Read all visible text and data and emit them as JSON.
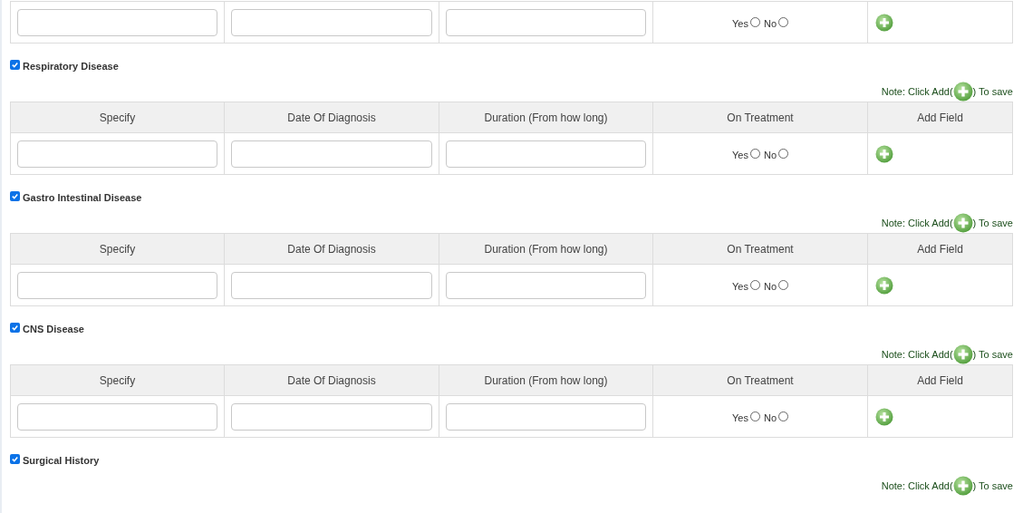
{
  "top_row": {
    "on_treatment": [
      {
        "label": "Yes",
        "selected": false
      },
      {
        "label": "No",
        "selected": false
      }
    ]
  },
  "sections": [
    {
      "title": "Respiratory Disease",
      "checked": true,
      "note": {
        "before": "Note: Click Add(",
        "after": ") To save"
      },
      "columns": [
        "Specify",
        "Date Of Diagnosis",
        "Duration (From how long)",
        "On Treatment",
        "Add Field"
      ],
      "rows": [
        {
          "on_treatment": [
            {
              "label": "Yes",
              "selected": false
            },
            {
              "label": "No",
              "selected": false
            }
          ]
        }
      ]
    },
    {
      "title": "Gastro Intestinal Disease",
      "checked": true,
      "note": {
        "before": "Note: Click Add(",
        "after": ") To save"
      },
      "columns": [
        "Specify",
        "Date Of Diagnosis",
        "Duration (From how long)",
        "On Treatment",
        "Add Field"
      ],
      "rows": [
        {
          "on_treatment": [
            {
              "label": "Yes",
              "selected": false
            },
            {
              "label": "No",
              "selected": false
            }
          ]
        }
      ]
    },
    {
      "title": "CNS Disease",
      "checked": true,
      "note": {
        "before": "Note: Click Add(",
        "after": ") To save"
      },
      "columns": [
        "Specify",
        "Date Of Diagnosis",
        "Duration (From how long)",
        "On Treatment",
        "Add Field"
      ],
      "rows": [
        {
          "on_treatment": [
            {
              "label": "Yes",
              "selected": false
            },
            {
              "label": "No",
              "selected": false
            }
          ]
        }
      ]
    },
    {
      "title": "Surgical History",
      "checked": true,
      "note": {
        "before": "Note: Click Add(",
        "after": ") To save"
      }
    }
  ]
}
